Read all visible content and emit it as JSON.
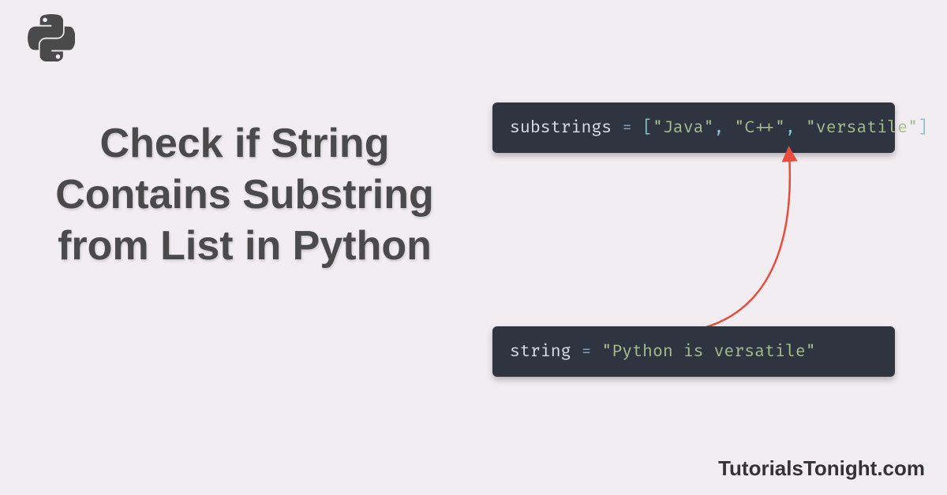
{
  "title": "Check if String Contains Substring from List in Python",
  "code1": {
    "var": "substrings",
    "eq": " = ",
    "open": "[",
    "v1": "\"Java\"",
    "c1": ", ",
    "v2": "\"C++\"",
    "c2": ", ",
    "v3": "\"versatile\"",
    "close": "]"
  },
  "code2": {
    "var": "string",
    "eq": " = ",
    "val": "\"Python is versatile\""
  },
  "footer": "TutorialsTonight.com",
  "logo": "python-logo"
}
